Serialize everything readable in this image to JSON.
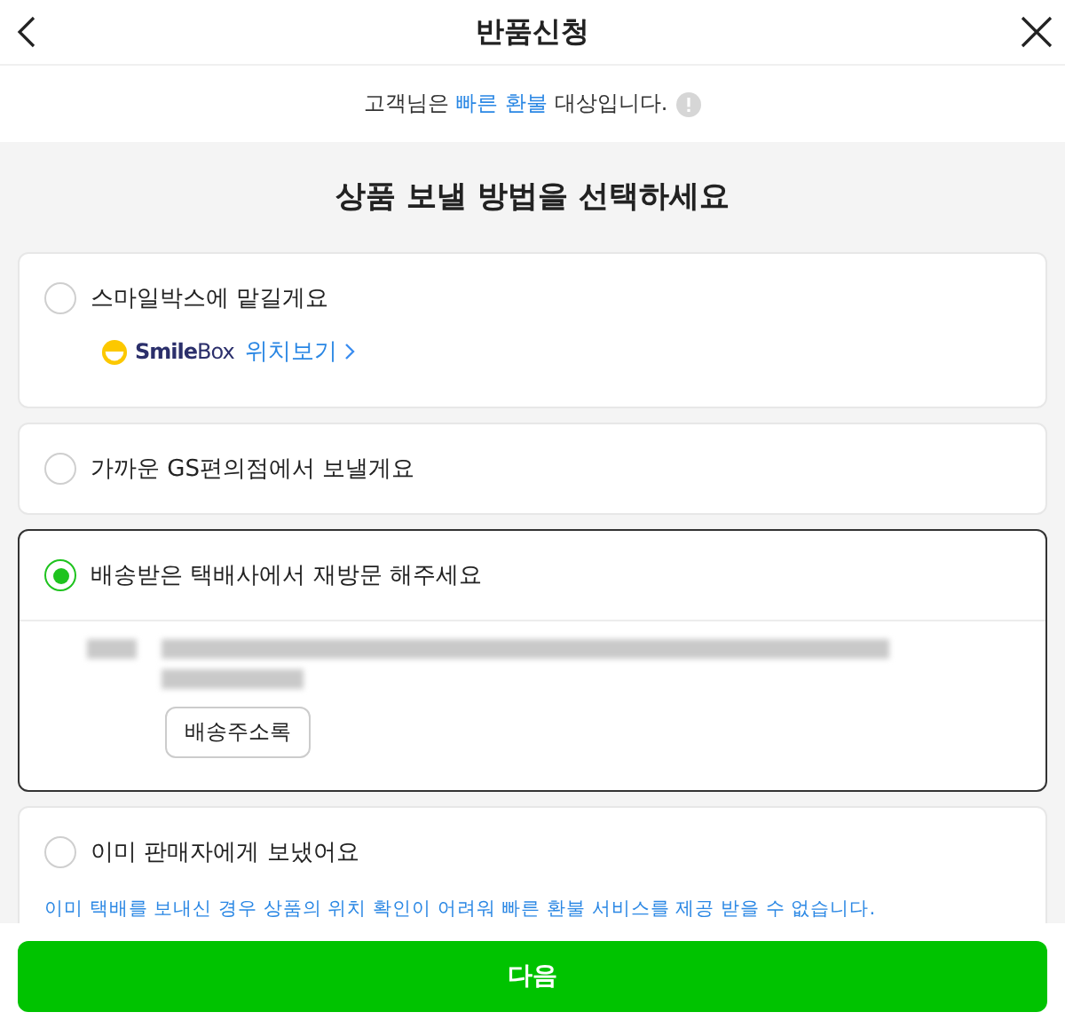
{
  "header": {
    "title": "반품신청"
  },
  "notice": {
    "before": "고객님은",
    "highlight": "빠른 환불",
    "after": "대상입니다."
  },
  "heading": "상품 보낼 방법을 선택하세요",
  "options": [
    {
      "kind": "smilebox",
      "label": "스마일박스에 맡길게요",
      "selected": false,
      "brand": "**Smile**Box",
      "link": "위치보기"
    },
    {
      "kind": "plain",
      "label": "가까운 GS편의점에서 보낼게요",
      "selected": false
    },
    {
      "kind": "address",
      "label": "배송받은 택배사에서 재방문 해주세요",
      "selected": true,
      "button": "배송주소록"
    },
    {
      "kind": "note",
      "label": "이미 판매자에게 보냈어요",
      "selected": false,
      "note": "이미 택배를 보내신 경우 상품의 위치 확인이 어려워 빠른 환불 서비스를 제공 받을 수 없습니다."
    }
  ],
  "next_button": "다음"
}
